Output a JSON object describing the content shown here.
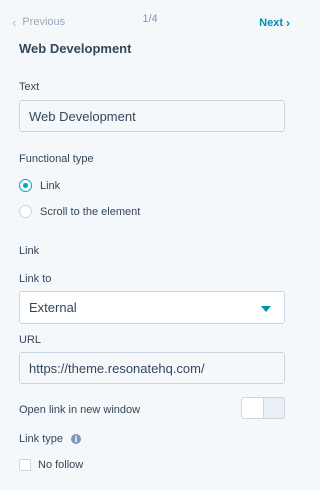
{
  "nav": {
    "previous_label": "Previous",
    "counter": "1/4",
    "next_label": "Next"
  },
  "panel": {
    "title": "Web Development"
  },
  "text_field": {
    "label": "Text",
    "value": "Web Development"
  },
  "functional_type": {
    "label": "Functional type",
    "options": [
      {
        "label": "Link",
        "selected": true
      },
      {
        "label": "Scroll to the element",
        "selected": false
      }
    ]
  },
  "link_section": {
    "heading": "Link"
  },
  "link_to": {
    "label": "Link to",
    "value": "External"
  },
  "url": {
    "label": "URL",
    "value": "https://theme.resonatehq.com/"
  },
  "new_window": {
    "label": "Open link in new window",
    "enabled": false
  },
  "link_type": {
    "label": "Link type",
    "info_icon": "i",
    "no_follow_label": "No follow",
    "no_follow_checked": false
  },
  "colors": {
    "accent": "#00a4bd",
    "link": "#0091ae",
    "text": "#33475b",
    "muted": "#99a9b9"
  }
}
